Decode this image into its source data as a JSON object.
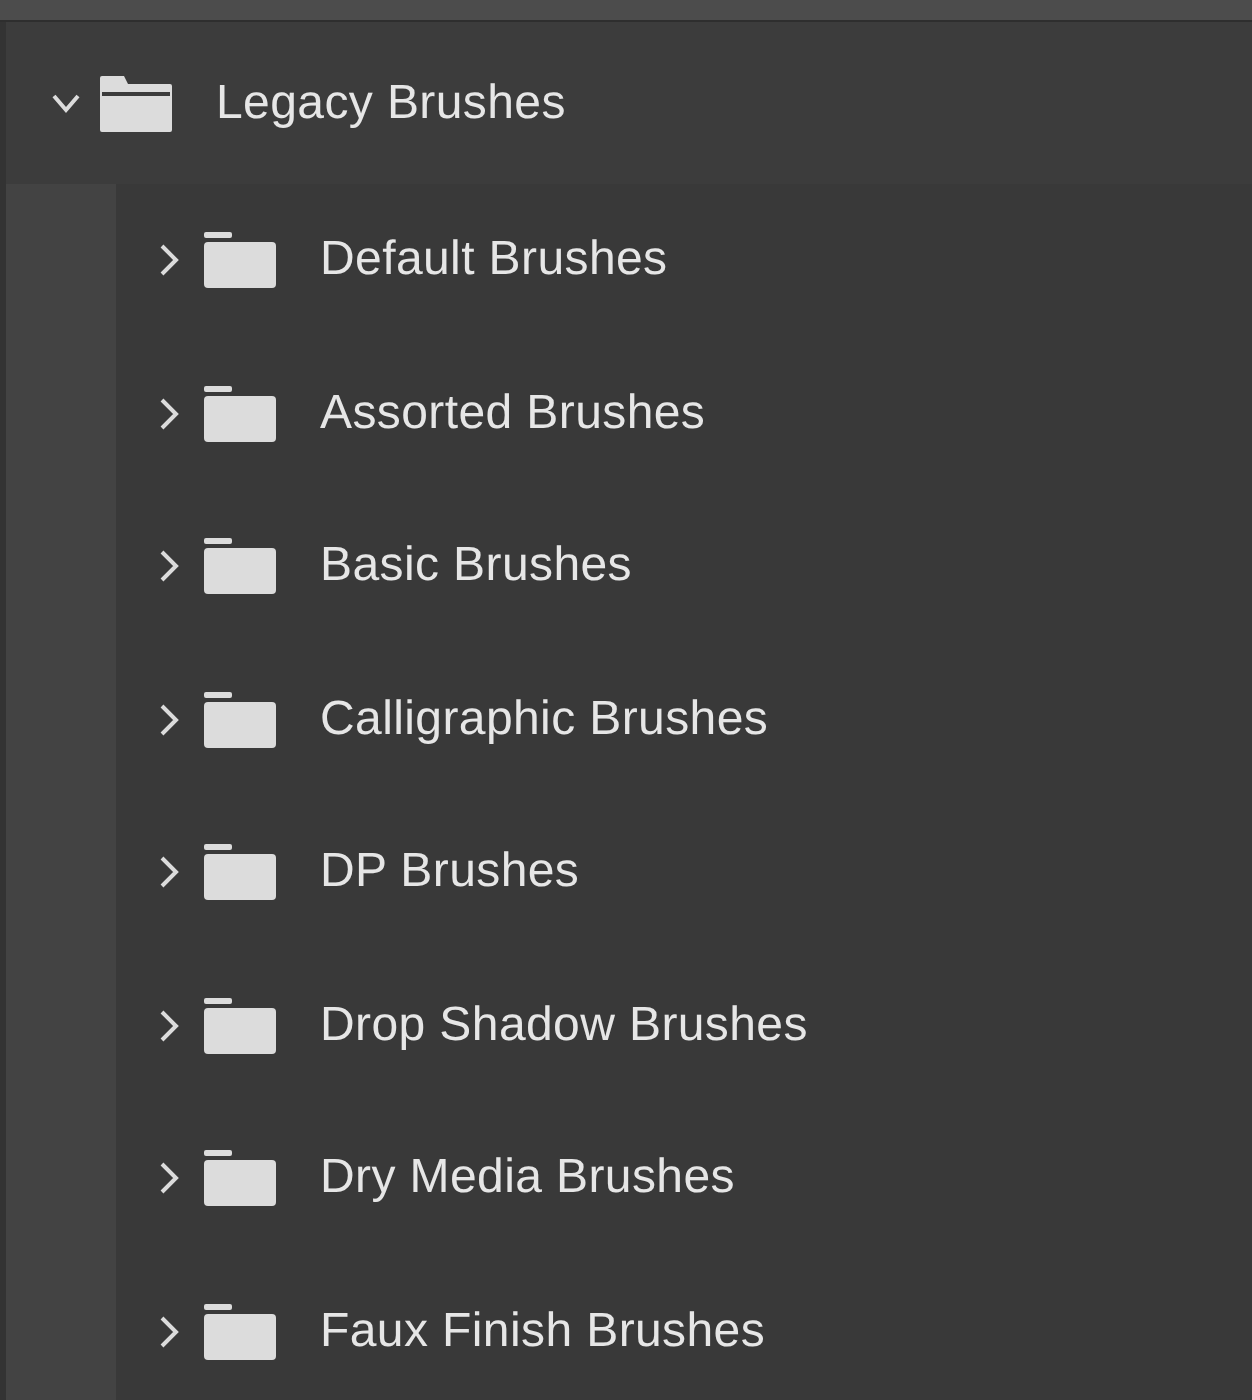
{
  "tree": [
    {
      "label": "Legacy Brushes",
      "expanded": true,
      "children": [
        {
          "label": "Default Brushes",
          "expanded": false
        },
        {
          "label": "Assorted Brushes",
          "expanded": false
        },
        {
          "label": "Basic Brushes",
          "expanded": false
        },
        {
          "label": "Calligraphic Brushes",
          "expanded": false
        },
        {
          "label": "DP Brushes",
          "expanded": false
        },
        {
          "label": "Drop Shadow Brushes",
          "expanded": false
        },
        {
          "label": "Dry Media Brushes",
          "expanded": false
        },
        {
          "label": "Faux Finish Brushes",
          "expanded": false
        }
      ]
    }
  ]
}
